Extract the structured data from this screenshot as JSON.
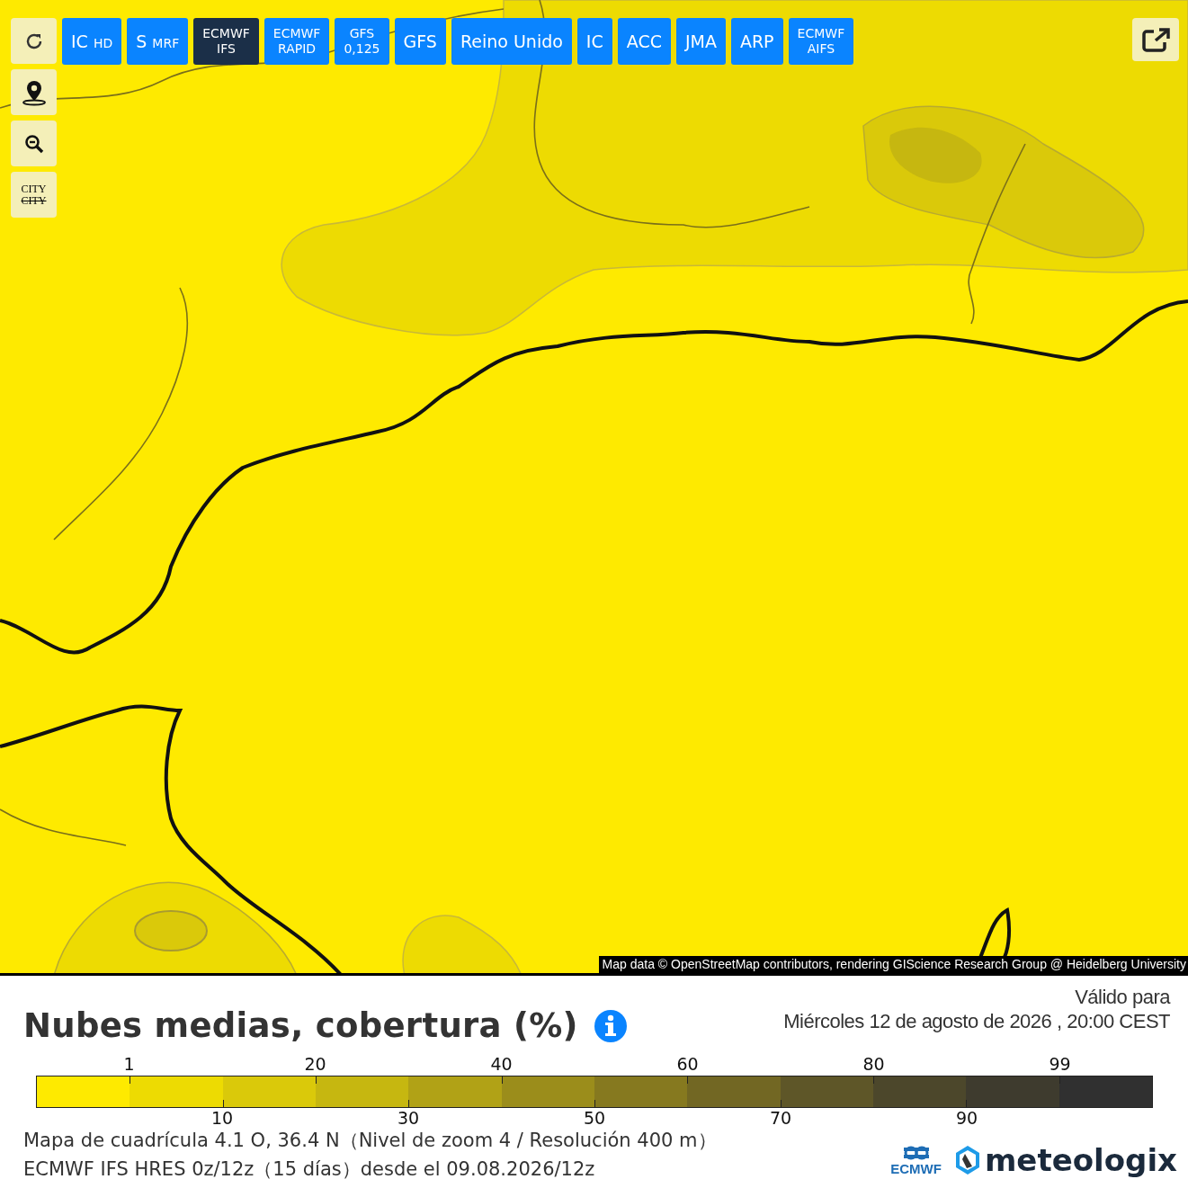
{
  "map_controls": [
    {
      "kind": "reload"
    },
    {
      "kind": "pin"
    },
    {
      "kind": "zoom-out"
    },
    {
      "kind": "city",
      "labels": [
        "CITY",
        "CITY"
      ]
    }
  ],
  "model_buttons": [
    {
      "label": "IC",
      "suffix": "HD",
      "selected": false
    },
    {
      "label": "S",
      "suffix": "MRF",
      "selected": false
    },
    {
      "label": "ECMWF\nIFS",
      "selected": true
    },
    {
      "label": "ECMWF\nRAPID",
      "selected": false
    },
    {
      "label": "GFS\n0,125",
      "selected": false
    },
    {
      "label": "GFS",
      "selected": false
    },
    {
      "label": "Reino Unido",
      "selected": false
    },
    {
      "label": "IC",
      "selected": false
    },
    {
      "label": "ACC",
      "selected": false
    },
    {
      "label": "JMA",
      "selected": false
    },
    {
      "label": "ARP",
      "selected": false
    },
    {
      "label": "ECMWF\nAIFS",
      "selected": false
    }
  ],
  "attribution": "Map data © OpenStreetMap contributors, rendering GIScience Research Group @ Heidelberg University",
  "title": "Nubes medias, cobertura (%)",
  "valid": {
    "label": "Válido para",
    "datetime": "Miércoles 12 de agosto de 2026 ,  20:00  CEST"
  },
  "legend": {
    "segments": [
      {
        "color": "#feea00"
      },
      {
        "color": "#eddb02"
      },
      {
        "color": "#dac90a"
      },
      {
        "color": "#c6b710"
      },
      {
        "color": "#b1a216"
      },
      {
        "color": "#9b8d1b"
      },
      {
        "color": "#86791f"
      },
      {
        "color": "#726723"
      },
      {
        "color": "#5e5628"
      },
      {
        "color": "#4c472b"
      },
      {
        "color": "#3e3b2e"
      },
      {
        "color": "#303030"
      }
    ],
    "ticks": [
      "1",
      "10",
      "20",
      "30",
      "40",
      "50",
      "60",
      "70",
      "80",
      "90",
      "99"
    ]
  },
  "footer_lines": [
    "Mapa de cuadrícula 4.1 O, 36.4 N（Nivel de zoom 4 / Resolución 400 m）",
    "ECMWF IFS HRES 0z/12z（15 días）desde el 09.08.2026/12z"
  ],
  "logos": {
    "ecmwf": "ECMWF",
    "brand": "meteologix"
  }
}
